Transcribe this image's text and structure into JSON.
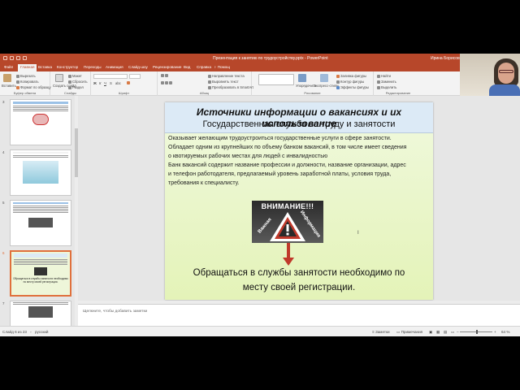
{
  "titlebar": {
    "title": "Презентация к занятию по трудоустройству.pptx  -  PowerPoint",
    "user": "Ирина Борисовна Кушнир"
  },
  "tabs": [
    "Файл",
    "Главная",
    "Вставка",
    "Конструктор",
    "Переходы",
    "Анимация",
    "Слайд-шоу",
    "Рецензирование",
    "Вид",
    "Справка"
  ],
  "tab_search": "Помощ",
  "ribbon": {
    "clipboard": {
      "paste": "Вставить",
      "cut": "Вырезать",
      "copy": "Копировать",
      "format": "Формат по образцу",
      "label": "Буфер обмена"
    },
    "slides": {
      "new_slide": "Создать слайд",
      "layout": "Макет",
      "reset": "Сбросить",
      "section": "Раздел",
      "label": "Слайды"
    },
    "font": {
      "label": "Шрифт"
    },
    "paragraph": {
      "direction": "Направление текста",
      "align_text": "Выровнять текст",
      "smartart": "Преобразовать в SmartArt",
      "label": "Абзац"
    },
    "drawing": {
      "arrange": "Упорядочить",
      "quick_styles": "Экспресс-стили",
      "fill": "Заливка фигуры",
      "outline": "Контур фигуры",
      "effects": "Эффекты фигуры",
      "label": "Рисование"
    },
    "editing": {
      "find": "Найти",
      "replace": "Заменить",
      "select": "Выделить",
      "label": "Редактирование"
    }
  },
  "thumbnails": [
    {
      "num": "3",
      "title": "Пассивные формы поиска работы"
    },
    {
      "num": "4",
      "title": "Пассивные формы поиска работы"
    },
    {
      "num": "5",
      "title": "Пассивные формы поиска работы"
    },
    {
      "num": "6",
      "title": "Источники информации о вакансиях"
    },
    {
      "num": "7",
      "title": "Программы обучения"
    }
  ],
  "thumb6_bottom": "Обращаться в службы занятости необходимо по месту своей регистрации.",
  "slide": {
    "title": "Источники информации о вакансиях и их использование",
    "subtitle": "Государственная служба по труду и занятости",
    "lines": [
      "Оказывает желающим трудоустроиться государственные услуги в сфере занятости.",
      "Обладает одним из крупнейших по объему банком вакансий, в том числе   имеет сведения",
      "о квотируемых рабочих местах для людей с инвалидностью",
      "Банк вакансий содержит название профессии и должности, название организации, адрес",
      "и телефон работодателя, предлагаемый уровень заработной платы, условия труда,",
      "требования к специалисту."
    ],
    "warning_title": "ВНИМАНИЕ!!!",
    "warning_left": "Важная",
    "warning_right": "Информация",
    "bottom_line1": "Обращаться в службы занятости необходимо      по",
    "bottom_line2": "месту своей регистрации."
  },
  "notes_placeholder": "Щелкните, чтобы добавить заметки",
  "status": {
    "slide": "Слайд 6 из 23",
    "language": "русский",
    "notes": "Заметки",
    "comments": "Примечания",
    "zoom": "64 %"
  },
  "colors": {
    "accent": "#b7472a",
    "slide_header": "#dceaf6",
    "slide_body": "#e4f3b8",
    "arrow": "#c0392b"
  }
}
